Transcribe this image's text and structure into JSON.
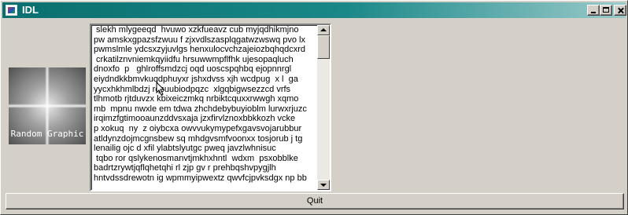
{
  "window": {
    "title": "IDL",
    "controls": {
      "minimize": "minimize-icon",
      "maximize": "maximize-icon",
      "close": "close-icon"
    }
  },
  "graphic": {
    "label": "Random Graphic"
  },
  "text_area": {
    "lines": [
      " slekh mlygeeqd  hvuwo xzkfueavz cub myjqdhikmjno",
      "pw amskxgpazsfzwuu f zjxvdlszasplqgatwzwswq pvo lx",
      "pwmslmle ydcsxzyjuvlgs henxulocvchzajeiozbqhqdcxrd",
      " crkatilznvniemkqyiidfu hrsuwwmpflfhk ujesopaqluch",
      "dnoxfo  p   ghlroffsmdzcj oqd uoscspqhbq ejopnnrgl",
      "eiydndkkbmvkuqdphuyxr jshxdvss xjh wcdpug  x l  ga",
      "yycxhkhmlbdzj rqsuubiodpqzc  xlgqbigwsezzcd vrfs",
      "tlhmotb rjtduvzx kbixeiczmkq nrbiktcquxxrwwgh xqmo",
      "mb  mpnu nwxle em tdwa zhchdebybuyioblm lurwxrjuzc",
      "irqimzfgtimooaunzddvsxaja jzxfirvlznoxbbkkozh vcke",
      "p xokuq  ny  z oiybcxa owvvukymypefxgavsvojarubbur",
      "atldynzdojmcgnsbew sq mhdgvsmfvoonxx tosjorub j tg",
      "lenailig ojc d xfil ylabtslyutgc pweq javzlwhnisuc",
      " tqbo ror qslykenosmanvtjmkhxhntl  wdxm  psxobblke",
      "badrtzrywtjqflqhetqhi rl zjp gv r prehbqshvpygjlh",
      "hntvdssdrewotn ig wpmmyipwextz qwvfcjpvksdgx np bb"
    ]
  },
  "scrollbar": {
    "position": 0.05
  },
  "quit_button": {
    "label": "Quit"
  },
  "colors": {
    "titlebar_start": "#0a6e6e",
    "titlebar_end": "#9acaca",
    "face": "#d4d0c8"
  }
}
